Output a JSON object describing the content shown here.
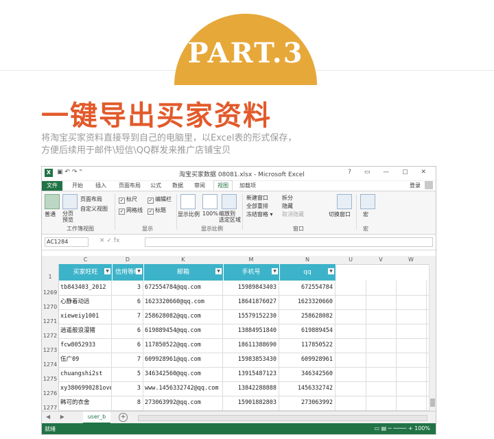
{
  "banner": {
    "part": "PART.3"
  },
  "heading": "一键导出买家资料",
  "subtitle": [
    "将淘宝买家资料直接导到自己的电脑里，以Excel表的形式保存，",
    "方便后续用于邮件\\短信\\QQ群发来推广店铺宝贝"
  ],
  "excel": {
    "window_title": "淘宝买家数据 08081.xlsx - Microsoft Excel",
    "controls": "? ▭ — ▢ ✕",
    "tabs": [
      "文件",
      "开始",
      "插入",
      "页面布局",
      "公式",
      "数据",
      "审阅",
      "视图",
      "加载项"
    ],
    "active_tab": "视图",
    "signin": "登录",
    "ribbon": {
      "normal": "普通",
      "page_break": "分页\n预览",
      "page_layout": "页面布局",
      "custom_views": "自定义视图",
      "group_views": "工作簿视图",
      "ruler": "标尺",
      "formula_bar": "编辑栏",
      "gridlines": "网格线",
      "headings": "标题",
      "group_show": "显示",
      "zoom": "显示比例",
      "zoom100": "100%",
      "zoom_sel": "缩放到\n选定区域",
      "group_zoom": "显示比例",
      "new_window": "新建窗口",
      "arrange_all": "全部重排",
      "freeze": "冻结窗格 ▾",
      "split": "拆分",
      "hide": "隐藏",
      "unhide": "取消隐藏",
      "switch_windows": "切换窗口",
      "group_window": "窗口",
      "macros": "宏",
      "group_macro": "宏"
    },
    "name_box": "AC1284",
    "columns": [
      "C",
      "D",
      "K",
      "M",
      "N",
      "U",
      "V",
      "W"
    ],
    "table_headers": [
      "买家旺旺",
      "信用等级",
      "邮箱",
      "手机号",
      "qq"
    ],
    "rows": [
      {
        "row": "1269",
        "name": "tb843403_2012",
        "level": "3",
        "email": "672554784@qq.com",
        "phone": "15989843403",
        "qq": "672554784"
      },
      {
        "row": "1270",
        "name": "心静着动远",
        "level": "6",
        "email": "1623320660@qq.com",
        "phone": "18641876027",
        "qq": "1623320660"
      },
      {
        "row": "1271",
        "name": "xieweiy1001",
        "level": "7",
        "email": "258628082@qq.com",
        "phone": "15579152230",
        "qq": "258628082"
      },
      {
        "row": "1272",
        "name": "逍遥般浪漫猪",
        "level": "6",
        "email": "619889454@qq.com",
        "phone": "13884951840",
        "qq": "619889454"
      },
      {
        "row": "1273",
        "name": "fcw8052933",
        "level": "6",
        "email": "117850522@qq.com",
        "phone": "18611388690",
        "qq": "117850522"
      },
      {
        "row": "1274",
        "name": "伍广09",
        "level": "7",
        "email": "609928961@qq.com",
        "phone": "15983853430",
        "qq": "609928961"
      },
      {
        "row": "1275",
        "name": "chuangshi2st",
        "level": "5",
        "email": "346342560@qq.com",
        "phone": "13915487123",
        "qq": "346342560"
      },
      {
        "row": "1276",
        "name": "xy3806990281ove",
        "level": "3",
        "email": "www.1456332742@qq.com",
        "phone": "13842288888",
        "qq": "1456332742"
      },
      {
        "row": "1277",
        "name": "韩可的衣舍",
        "level": "8",
        "email": "273063992@qq.com",
        "phone": "15901882803",
        "qq": "273063992"
      }
    ],
    "header_row_num": "1",
    "sheet_tab": "user_b",
    "status": "就绪",
    "zoom_status": "▭ ▤ ─  ──── + 100%"
  }
}
